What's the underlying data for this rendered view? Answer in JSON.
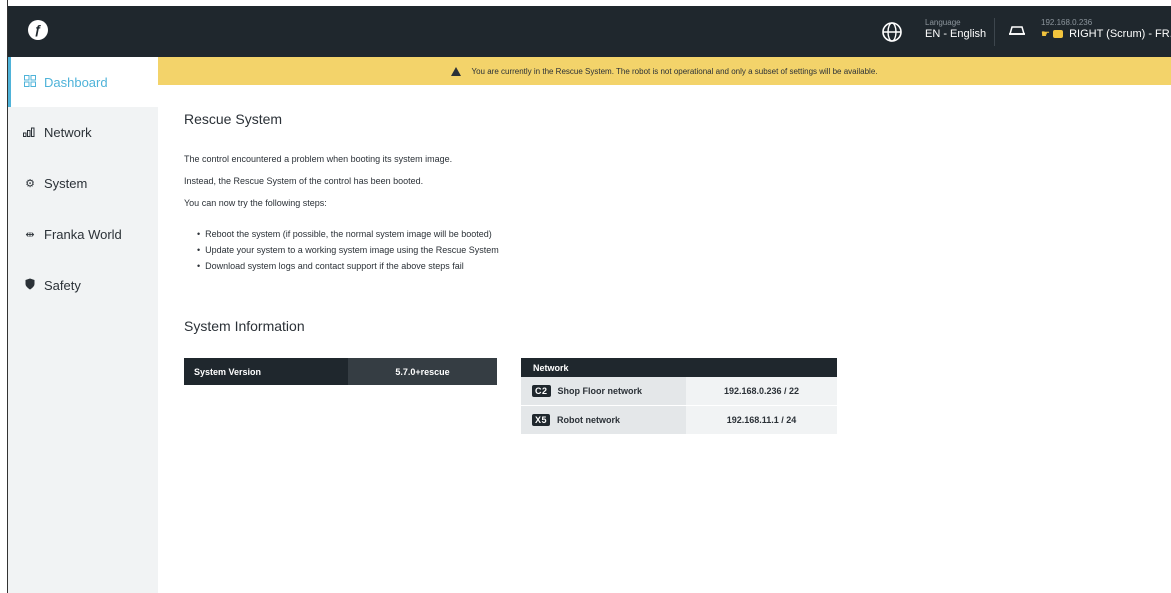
{
  "header": {
    "logo_icon": "franka-logo-icon",
    "language_label": "Language",
    "language_value": "EN - English",
    "robot_ip": "192.168.0.236",
    "robot_name": "RIGHT (Scrum) - FR..."
  },
  "sidebar": {
    "items": [
      {
        "label": "Dashboard",
        "icon": "dashboard-icon",
        "active": true
      },
      {
        "label": "Network",
        "icon": "network-bars-icon"
      },
      {
        "label": "System",
        "icon": "gear-icon"
      },
      {
        "label": "Franka World",
        "icon": "franka-world-icon"
      },
      {
        "label": "Safety",
        "icon": "shield-icon"
      }
    ]
  },
  "banner": {
    "text": "You are currently in the Rescue System. The robot is not operational and only a subset of settings will be available."
  },
  "rescue": {
    "title": "Rescue System",
    "p1": "The control encountered a problem when booting its system image.",
    "p2": "Instead, the Rescue System of the control has been booted.",
    "p3": "You can now try the following steps:",
    "steps": [
      "Reboot the system (if possible, the normal system image will be booted)",
      "Update your system to a working system image using the Rescue System",
      "Download system logs and contact support if the above steps fail"
    ]
  },
  "sysinfo": {
    "title": "System Information",
    "version_label": "System Version",
    "version_value": "5.7.0+rescue"
  },
  "network": {
    "header": "Network",
    "rows": [
      {
        "tag": "C2",
        "label": "Shop Floor network",
        "value": "192.168.0.236 / 22"
      },
      {
        "tag": "X5",
        "label": "Robot network",
        "value": "192.168.11.1 / 24"
      }
    ]
  },
  "colors": {
    "topbar": "#1f272d",
    "accent": "#4fb3d9",
    "banner": "#f3d36a"
  }
}
